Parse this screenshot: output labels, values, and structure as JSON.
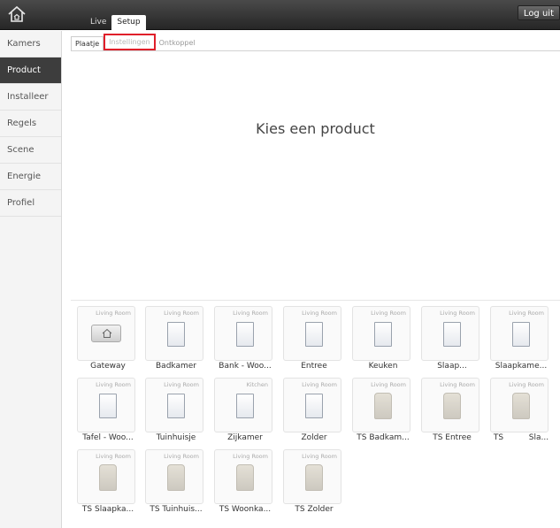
{
  "header": {
    "tabs": [
      {
        "label": "Live",
        "active": false
      },
      {
        "label": "Setup",
        "active": true
      }
    ],
    "logout_label": "Log uit"
  },
  "sidebar": {
    "items": [
      {
        "label": "Kamers",
        "active": false
      },
      {
        "label": "Product",
        "active": true
      },
      {
        "label": "Installeer",
        "active": false
      },
      {
        "label": "Regels",
        "active": false
      },
      {
        "label": "Scene",
        "active": false
      },
      {
        "label": "Energie",
        "active": false
      },
      {
        "label": "Profiel",
        "active": false
      }
    ]
  },
  "subtabs": [
    {
      "label": "Plaatje",
      "active": true
    },
    {
      "label": "Instellingen",
      "highlighted": true
    },
    {
      "label": "Ontkoppel",
      "active": false
    }
  ],
  "main": {
    "title": "Kies een product"
  },
  "products": [
    {
      "room": "Living Room",
      "name": "Gateway",
      "icon": "gateway-icon"
    },
    {
      "room": "Living Room",
      "name": "Badkamer",
      "icon": "wall-switch-icon"
    },
    {
      "room": "Living Room",
      "name": "Bank - Woo...",
      "icon": "wall-switch-icon"
    },
    {
      "room": "Living Room",
      "name": "Entree",
      "icon": "wall-switch-icon"
    },
    {
      "room": "Living Room",
      "name": "Keuken",
      "icon": "wall-switch-icon"
    },
    {
      "room": "Living Room",
      "name": "Slaap...",
      "icon": "wall-switch-icon"
    },
    {
      "room": "Living Room",
      "name": "Slaapkame...",
      "icon": "wall-switch-icon"
    },
    {
      "room": "Living Room",
      "name": "Tafel - Woo...",
      "icon": "wall-switch-icon"
    },
    {
      "room": "Living Room",
      "name": "Tuinhuisje",
      "icon": "wall-switch-icon"
    },
    {
      "room": "Kitchen",
      "name": "Zijkamer",
      "icon": "wall-switch-icon"
    },
    {
      "room": "Living Room",
      "name": "Zolder",
      "icon": "wall-switch-icon"
    },
    {
      "room": "Living Room",
      "name": "TS Badkam...",
      "icon": "thermostat-icon"
    },
    {
      "room": "Living Room",
      "name": "TS Entree",
      "icon": "thermostat-icon"
    },
    {
      "room": "Living Room",
      "name": "TS          Sla...",
      "icon": "thermostat-icon"
    },
    {
      "room": "Living Room",
      "name": "TS Slaapka...",
      "icon": "thermostat-icon"
    },
    {
      "room": "Living Room",
      "name": "TS Tuinhuis...",
      "icon": "thermostat-icon"
    },
    {
      "room": "Living Room",
      "name": "TS Woonka...",
      "icon": "thermostat-icon"
    },
    {
      "room": "Living Room",
      "name": "TS Zolder",
      "icon": "thermostat-icon"
    }
  ],
  "colors": {
    "topbar": "#2e2e2e",
    "sidebar_active": "#3d3d3d",
    "highlight_border": "#e01f2a"
  }
}
